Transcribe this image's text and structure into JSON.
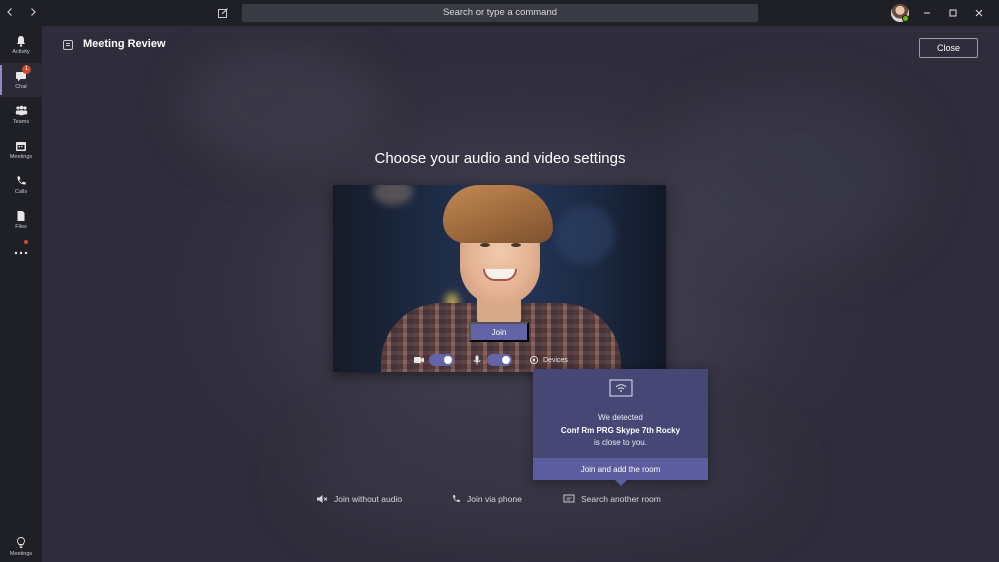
{
  "titlebar": {
    "search_placeholder": "Search or type a command",
    "icons": [
      "back-arrow-icon",
      "forward-arrow-icon",
      "compose-icon",
      "minimize-icon",
      "maximize-icon",
      "close-icon"
    ]
  },
  "rail": {
    "items": [
      {
        "label": "Activity",
        "icon": "bell-icon"
      },
      {
        "label": "Chat",
        "icon": "chat-icon",
        "badge": "1"
      },
      {
        "label": "Teams",
        "icon": "teams-icon"
      },
      {
        "label": "Meetings",
        "icon": "calendar-icon"
      },
      {
        "label": "Calls",
        "icon": "phone-icon"
      },
      {
        "label": "Files",
        "icon": "file-icon"
      },
      {
        "label": "",
        "icon": "more-icon"
      }
    ],
    "bottom_label": "Meetings"
  },
  "header": {
    "title": "Meeting Review",
    "close_label": "Close"
  },
  "prejoin": {
    "heading": "Choose your audio and video settings",
    "join_label": "Join",
    "devices_label": "Devices",
    "camera_on": true,
    "mic_on": true
  },
  "room_popup": {
    "line1": "We detected",
    "room_name": "Conf Rm PRG Skype 7th Rocky",
    "line3": "is close to you.",
    "action_label": "Join and add the room"
  },
  "options": {
    "no_audio": "Join without audio",
    "phone": "Join via phone",
    "search_room": "Search another room"
  },
  "colors": {
    "accent": "#6264a7",
    "popup": "#464775",
    "rail": "#1f1f26"
  }
}
